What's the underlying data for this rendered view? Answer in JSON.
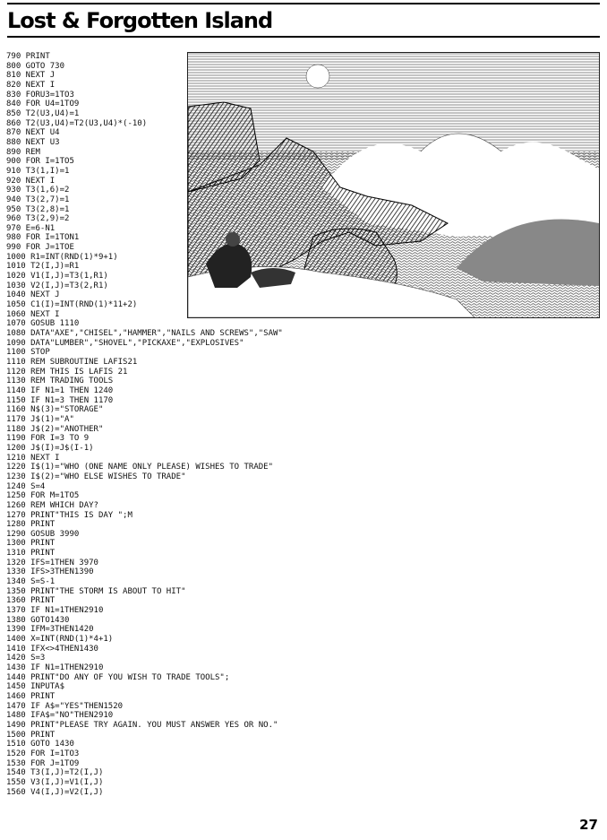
{
  "page": {
    "title": "Lost & Forgotten Island",
    "page_number": "27"
  },
  "listing": [
    "790 PRINT",
    "800 GOTO 730",
    "810 NEXT J",
    "820 NEXT I",
    "830 FORU3=1TO3",
    "840 FOR U4=1TO9",
    "850 T2(U3,U4)=1",
    "860 T2(U3,U4)=T2(U3,U4)*(-10)",
    "870 NEXT U4",
    "880 NEXT U3",
    "890 REM",
    "900 FOR I=1TO5",
    "910 T3(1,I)=1",
    "920 NEXT I",
    "930 T3(1,6)=2",
    "940 T3(2,7)=1",
    "950 T3(2,8)=1",
    "960 T3(2,9)=2",
    "970 E=6-N1",
    "980 FOR I=1TON1",
    "990 FOR J=1TOE",
    "1000 R1=INT(RND(1)*9+1)",
    "1010 T2(I,J)=R1",
    "1020 V1(I,J)=T3(1,R1)",
    "1030 V2(I,J)=T3(2,R1)",
    "1040 NEXT J",
    "1050 C1(I)=INT(RND(1)*11+2)",
    "1060 NEXT I",
    "1070 GOSUB 1110",
    "1080 DATA\"AXE\",\"CHISEL\",\"HAMMER\",\"NAILS AND SCREWS\",\"SAW\"",
    "1090 DATA\"LUMBER\",\"SHOVEL\",\"PICKAXE\",\"EXPLOSIVES\"",
    "1100 STOP",
    "1110 REM SUBROUTINE LAFIS21",
    "1120 REM THIS IS LAFIS 21",
    "1130 REM TRADING TOOLS",
    "1140 IF N1=1 THEN 1240",
    "1150 IF N1=3 THEN 1170",
    "1160 N$(3)=\"STORAGE\"",
    "1170 J$(1)=\"A\"",
    "1180 J$(2)=\"ANOTHER\"",
    "1190 FOR I=3 TO 9",
    "1200 J$(I)=J$(I-1)",
    "1210 NEXT I",
    "1220 I$(1)=\"WHO (ONE NAME ONLY PLEASE) WISHES TO TRADE\"",
    "1230 I$(2)=\"WHO ELSE WISHES TO TRADE\"",
    "1240 S=4",
    "1250 FOR M=1TO5",
    "1260 REM WHICH DAY?",
    "1270 PRINT\"THIS IS DAY \";M",
    "1280 PRINT",
    "1290 GOSUB 3990",
    "1300 PRINT",
    "1310 PRINT",
    "1320 IFS=1THEN 3970",
    "1330 IFS>3THEN1390",
    "1340 S=S-1",
    "1350 PRINT\"THE STORM IS ABOUT TO HIT\"",
    "1360 PRINT",
    "1370 IF N1=1THEN2910",
    "1380 GOTO1430",
    "1390 IFM=3THEN1420",
    "1400 X=INT(RND(1)*4+1)",
    "1410 IFX<>4THEN1430",
    "1420 S=3",
    "1430 IF N1=1THEN2910",
    "1440 PRINT\"DO ANY OF YOU WISH TO TRADE TOOLS\";",
    "1450 INPUTA$",
    "1460 PRINT",
    "1470 IF A$=\"YES\"THEN1520",
    "1480 IFA$=\"NO\"THEN2910",
    "1490 PRINT\"PLEASE TRY AGAIN. YOU MUST ANSWER YES OR NO.\"",
    "1500 PRINT",
    "1510 GOTO 1430",
    "1520 FOR I=1TO3",
    "1530 FOR J=1TO9",
    "1540 T3(I,J)=T2(I,J)",
    "1550 V3(I,J)=V1(I,J)",
    "1560 V4(I,J)=V2(I,J)"
  ]
}
